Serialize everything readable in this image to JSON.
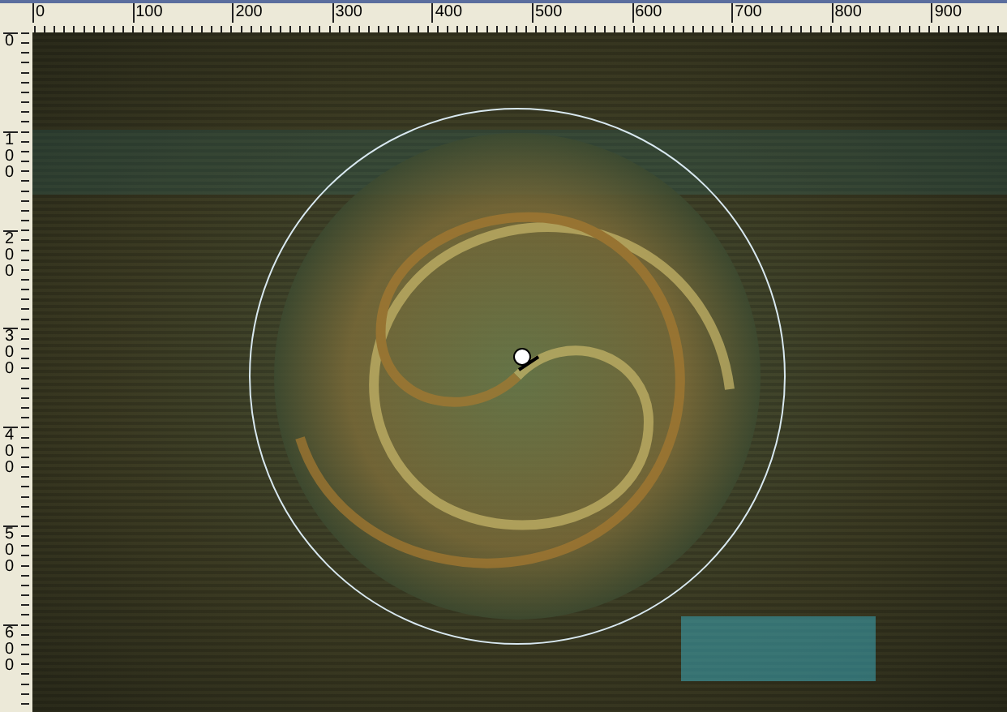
{
  "rulers": {
    "horizontal": [
      "0",
      "100",
      "200",
      "300",
      "400",
      "500",
      "600",
      "700",
      "800",
      "900"
    ],
    "vertical": [
      "0",
      "100",
      "200",
      "300",
      "400",
      "500",
      "600"
    ]
  }
}
